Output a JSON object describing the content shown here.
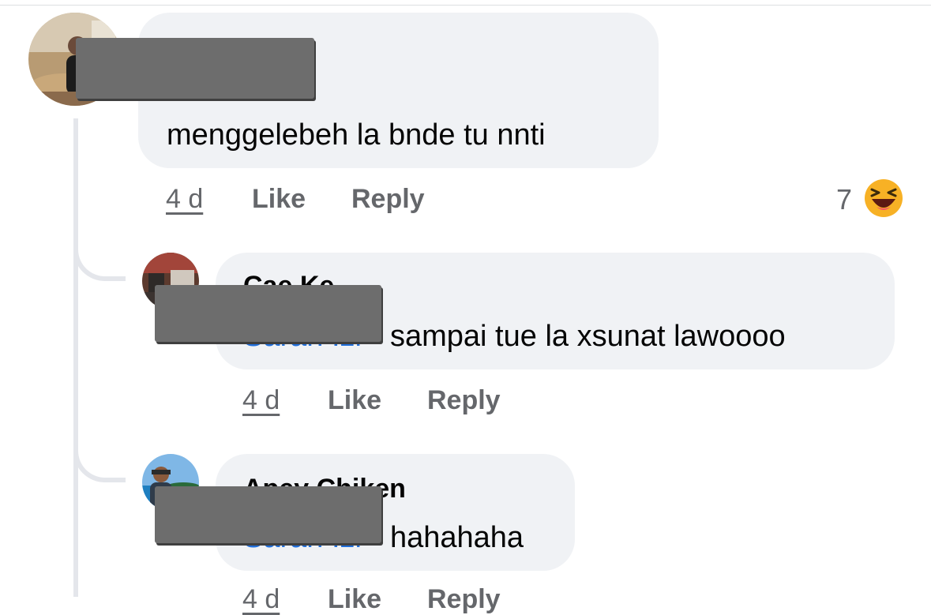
{
  "comments": [
    {
      "author": "",
      "message": "menggelebeh la bnde tu nnti",
      "time": "4 d",
      "like_label": "Like",
      "reply_label": "Reply",
      "reaction_count": "7",
      "reaction_icon": "laughing-reaction-icon"
    }
  ],
  "replies": [
    {
      "author": "Cae Ke",
      "mention": "Sarah Izi",
      "message": "sampai tue la xsunat lawoooo",
      "time": "4 d",
      "like_label": "Like",
      "reply_label": "Reply"
    },
    {
      "author": "Apey Chiken",
      "mention": "Sarah Izi",
      "message": "hahahaha",
      "time": "4 d",
      "like_label": "Like",
      "reply_label": "Reply"
    }
  ],
  "colors": {
    "bubble": "#f0f2f5",
    "mention": "#216fdb",
    "meta": "#65676b",
    "reaction": "#f7b125"
  }
}
